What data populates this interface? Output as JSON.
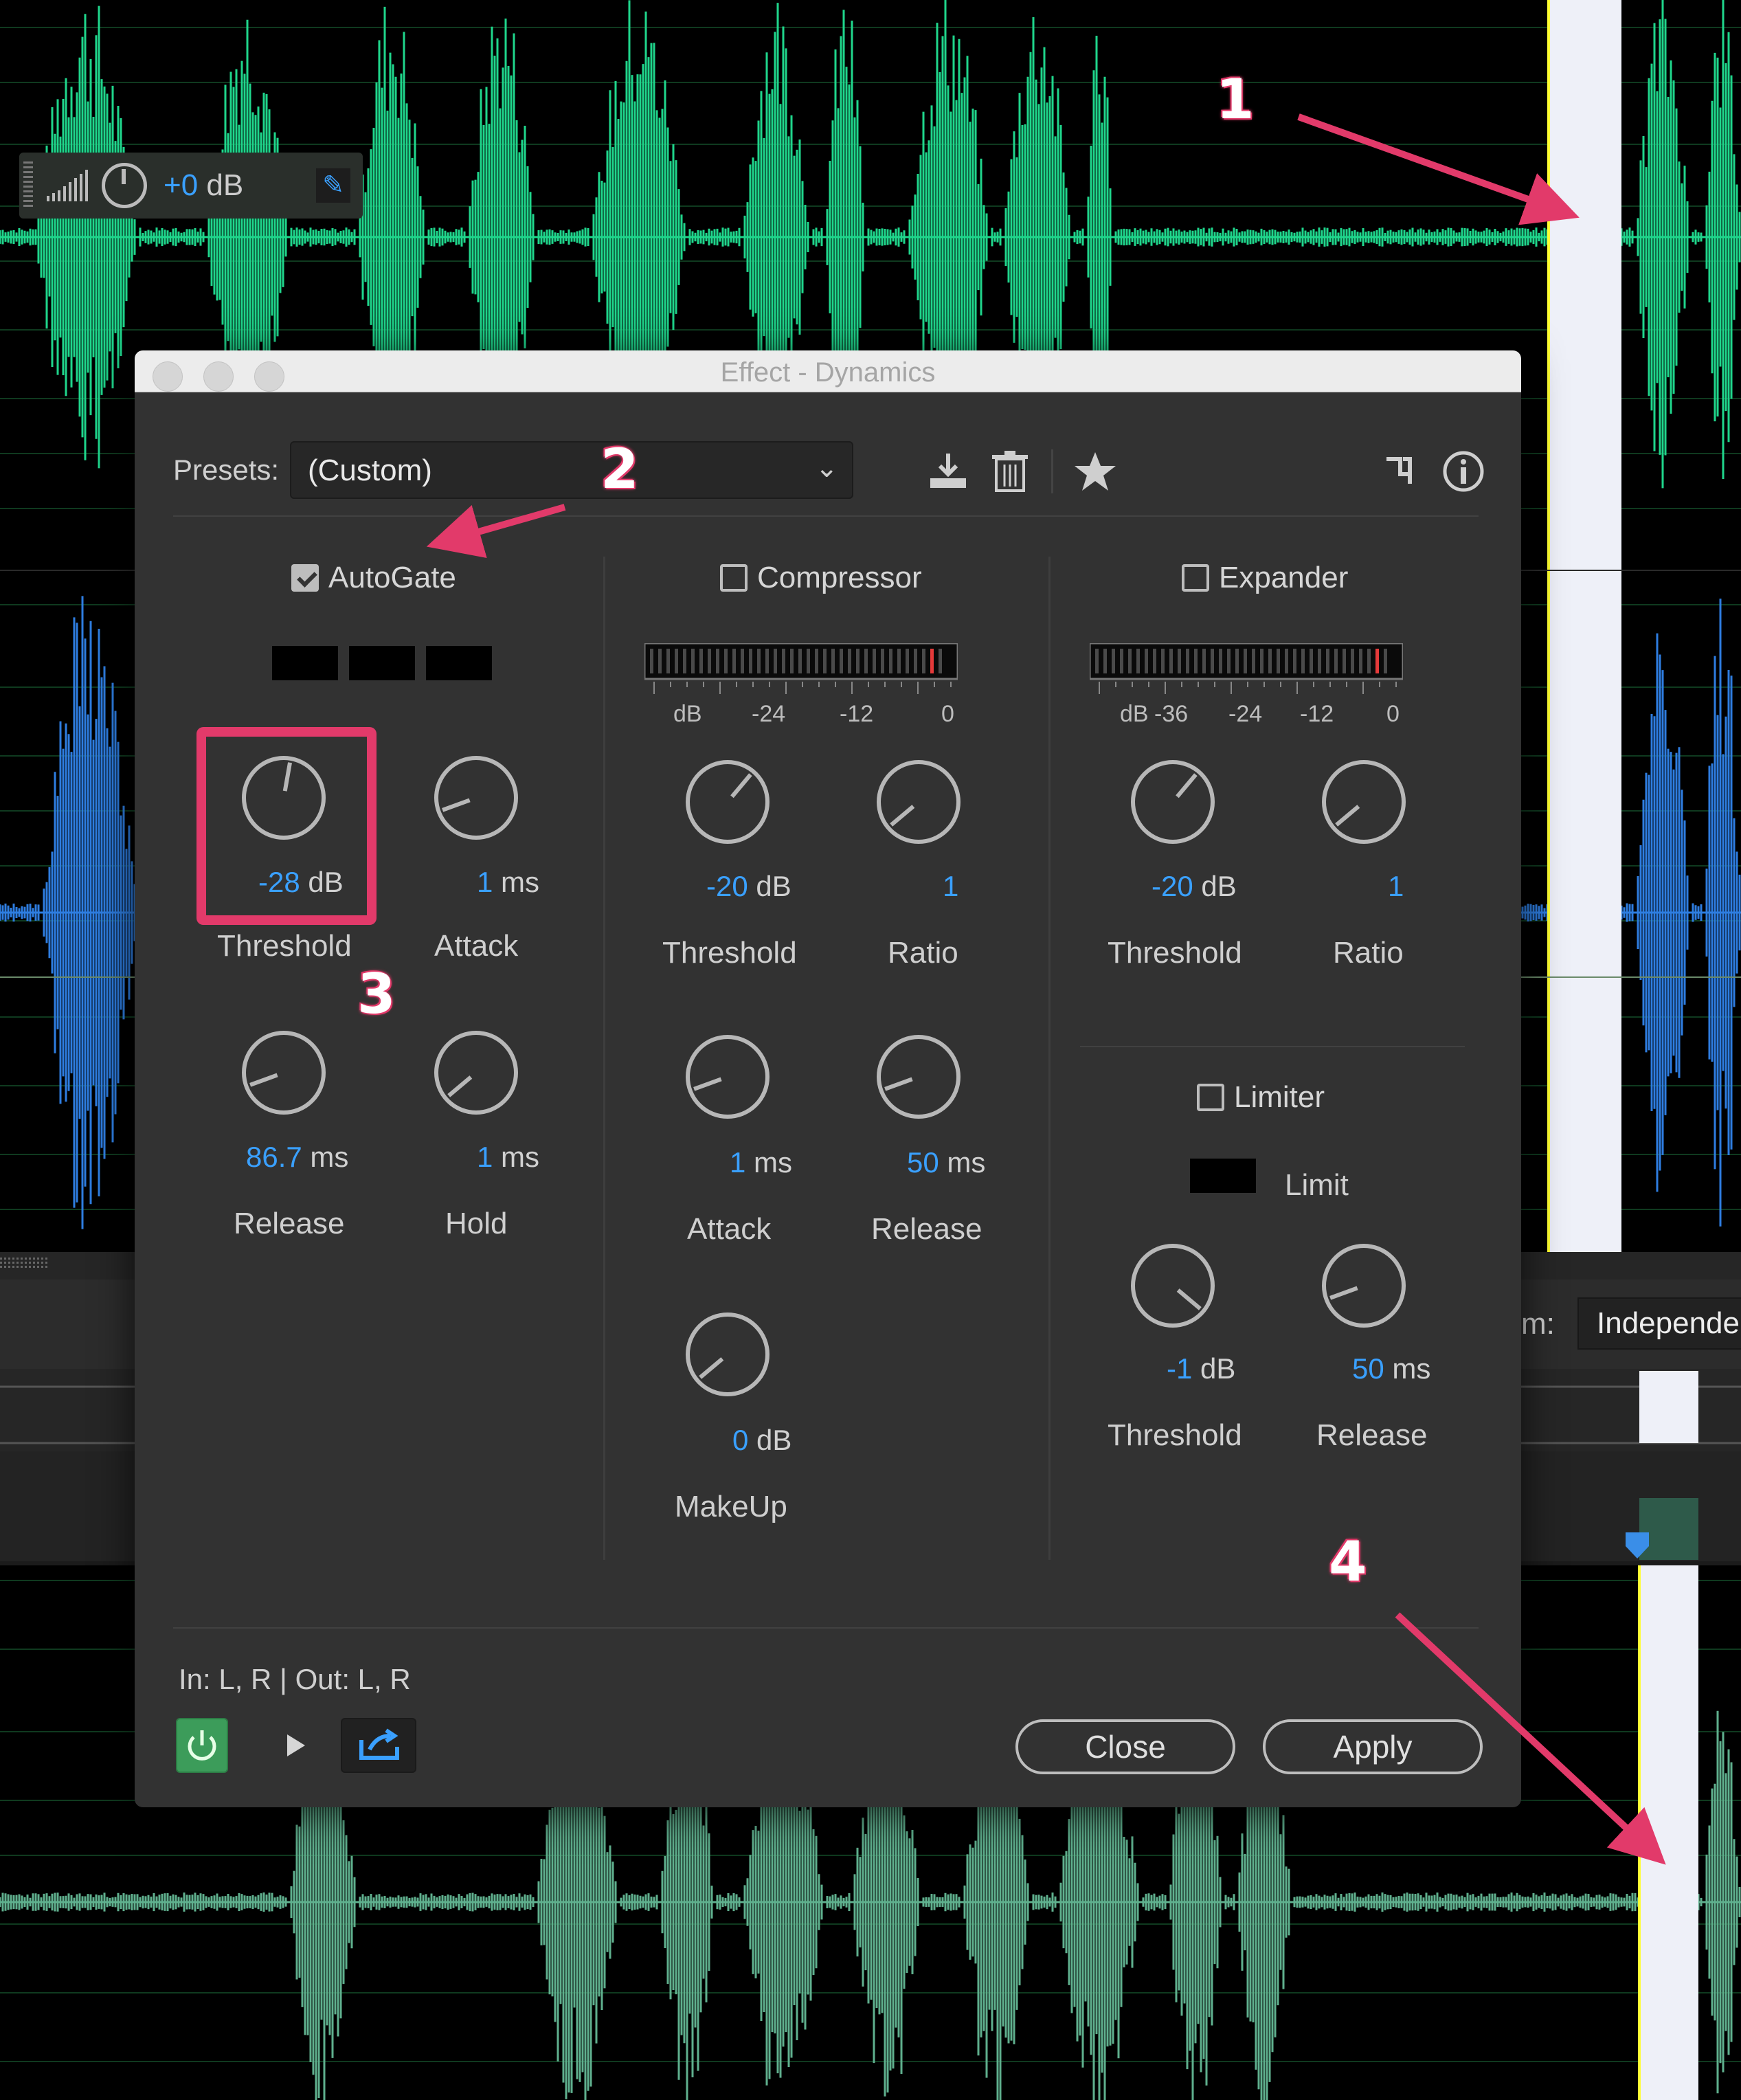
{
  "clip_volume": {
    "prefix": "+0",
    "unit": "dB"
  },
  "window": {
    "title": "Effect - Dynamics"
  },
  "presets": {
    "label": "Presets:",
    "value": "(Custom)"
  },
  "autogate": {
    "label": "AutoGate",
    "checked": true,
    "threshold": {
      "value": "-28",
      "unit": "dB",
      "label": "Threshold"
    },
    "attack": {
      "value": "1",
      "unit": "ms",
      "label": "Attack"
    },
    "release": {
      "value": "86.7",
      "unit": "ms",
      "label": "Release"
    },
    "hold": {
      "value": "1",
      "unit": "ms",
      "label": "Hold"
    }
  },
  "compressor": {
    "label": "Compressor",
    "checked": false,
    "scale": [
      "dB",
      "-24",
      "-12",
      "0"
    ],
    "threshold": {
      "value": "-20",
      "unit": "dB",
      "label": "Threshold"
    },
    "ratio": {
      "value": "1",
      "label": "Ratio"
    },
    "attack": {
      "value": "1",
      "unit": "ms",
      "label": "Attack"
    },
    "release": {
      "value": "50",
      "unit": "ms",
      "label": "Release"
    },
    "makeup": {
      "value": "0",
      "unit": "dB",
      "label": "MakeUp"
    }
  },
  "expander": {
    "label": "Expander",
    "checked": false,
    "scale": [
      "dB",
      "-36",
      "-24",
      "-12",
      "0"
    ],
    "threshold": {
      "value": "-20",
      "unit": "dB",
      "label": "Threshold"
    },
    "ratio": {
      "value": "1",
      "label": "Ratio"
    }
  },
  "limiter": {
    "label": "Limiter",
    "checked": false,
    "limit_label": "Limit",
    "threshold": {
      "value": "-1",
      "unit": "dB",
      "label": "Threshold"
    },
    "release": {
      "value": "50",
      "unit": "ms",
      "label": "Release"
    }
  },
  "footer": {
    "io": "In: L, R | Out: L, R",
    "close": "Close",
    "apply": "Apply"
  },
  "background": {
    "m_label": "m:",
    "channel_mode": "Independe"
  },
  "annotations": [
    "1",
    "2",
    "3",
    "4"
  ],
  "colors": {
    "waveform_top": "#1fd68c",
    "waveform_mid": "#2e7de0",
    "waveform_bottom": "#5fb08e",
    "accent": "#3aa0ff",
    "highlight": "#e23a6a",
    "power_on": "#3c9c5a"
  }
}
